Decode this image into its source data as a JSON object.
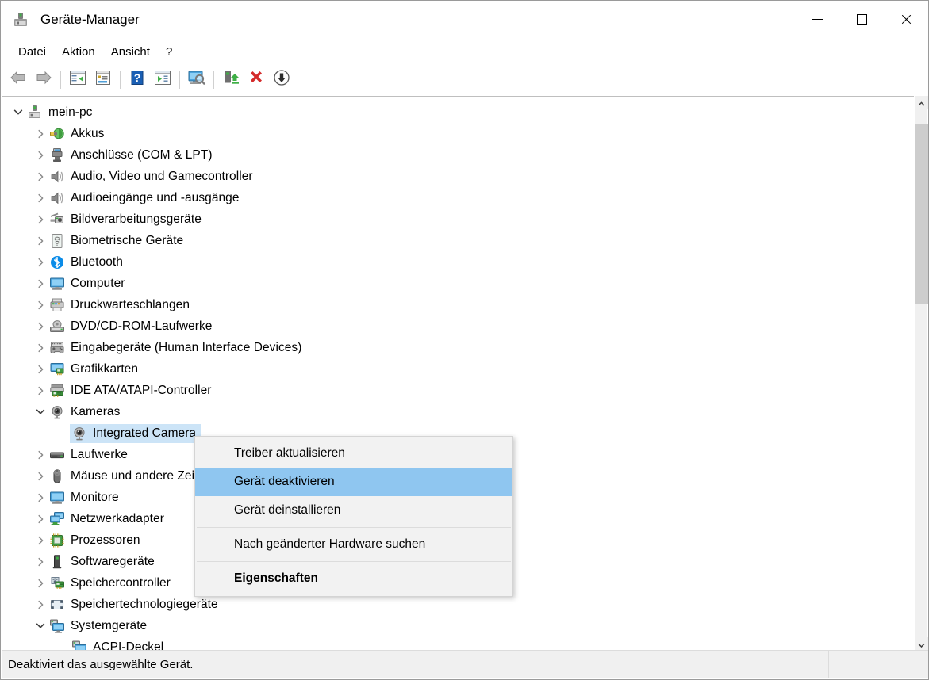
{
  "window": {
    "title": "Geräte-Manager",
    "icon": "device-manager-icon",
    "controls": {
      "minimize": "minimize-icon",
      "maximize": "maximize-icon",
      "close": "close-icon"
    }
  },
  "menubar": {
    "items": [
      {
        "label": "Datei",
        "name": "menu-datei"
      },
      {
        "label": "Aktion",
        "name": "menu-aktion"
      },
      {
        "label": "Ansicht",
        "name": "menu-ansicht"
      },
      {
        "label": "?",
        "name": "menu-hilfe"
      }
    ]
  },
  "toolbar": {
    "buttons": [
      {
        "icon": "back-arrow-icon",
        "name": "toolbar-back"
      },
      {
        "icon": "forward-arrow-icon",
        "name": "toolbar-forward"
      },
      {
        "sep": true
      },
      {
        "icon": "show-hide-console-tree-icon",
        "name": "toolbar-console-tree"
      },
      {
        "icon": "properties-icon",
        "name": "toolbar-properties"
      },
      {
        "sep": true
      },
      {
        "icon": "help-question-icon",
        "name": "toolbar-help"
      },
      {
        "icon": "update-driver-icon",
        "name": "toolbar-update-driver"
      },
      {
        "sep": true
      },
      {
        "icon": "scan-hardware-icon",
        "name": "toolbar-scan-hardware"
      },
      {
        "sep": true
      },
      {
        "icon": "enable-device-icon",
        "name": "toolbar-enable-device"
      },
      {
        "icon": "uninstall-device-red-x-icon",
        "name": "toolbar-uninstall-device"
      },
      {
        "icon": "disable-device-down-arrow-icon",
        "name": "toolbar-disable-device"
      }
    ]
  },
  "tree": {
    "rows": [
      {
        "label": "mein-pc",
        "depth": 0,
        "state": "expanded",
        "icon": "computer-root-icon",
        "selected": false
      },
      {
        "label": "Akkus",
        "depth": 1,
        "state": "collapsed",
        "icon": "battery-icon",
        "selected": false
      },
      {
        "label": "Anschlüsse (COM & LPT)",
        "depth": 1,
        "state": "collapsed",
        "icon": "port-connector-icon",
        "selected": false
      },
      {
        "label": "Audio, Video und Gamecontroller",
        "depth": 1,
        "state": "collapsed",
        "icon": "speaker-icon",
        "selected": false
      },
      {
        "label": "Audioeingänge und -ausgänge",
        "depth": 1,
        "state": "collapsed",
        "icon": "speaker-icon",
        "selected": false
      },
      {
        "label": "Bildverarbeitungsgeräte",
        "depth": 1,
        "state": "collapsed",
        "icon": "imaging-scanner-icon",
        "selected": false
      },
      {
        "label": "Biometrische Geräte",
        "depth": 1,
        "state": "collapsed",
        "icon": "fingerprint-icon",
        "selected": false
      },
      {
        "label": "Bluetooth",
        "depth": 1,
        "state": "collapsed",
        "icon": "bluetooth-icon",
        "selected": false
      },
      {
        "label": "Computer",
        "depth": 1,
        "state": "collapsed",
        "icon": "monitor-icon",
        "selected": false
      },
      {
        "label": "Druckwarteschlangen",
        "depth": 1,
        "state": "collapsed",
        "icon": "printer-icon",
        "selected": false
      },
      {
        "label": "DVD/CD-ROM-Laufwerke",
        "depth": 1,
        "state": "collapsed",
        "icon": "optical-drive-icon",
        "selected": false
      },
      {
        "label": "Eingabegeräte (Human Interface Devices)",
        "depth": 1,
        "state": "collapsed",
        "icon": "gamepad-hid-icon",
        "selected": false
      },
      {
        "label": "Grafikkarten",
        "depth": 1,
        "state": "collapsed",
        "icon": "display-adapter-icon",
        "selected": false
      },
      {
        "label": "IDE ATA/ATAPI-Controller",
        "depth": 1,
        "state": "collapsed",
        "icon": "ide-controller-icon",
        "selected": false
      },
      {
        "label": "Kameras",
        "depth": 1,
        "state": "expanded",
        "icon": "camera-icon",
        "selected": false
      },
      {
        "label": "Integrated Camera",
        "depth": 2,
        "state": "leaf",
        "icon": "camera-icon",
        "selected": true
      },
      {
        "label": "Laufwerke",
        "depth": 1,
        "state": "collapsed",
        "icon": "disk-drive-icon",
        "selected": false
      },
      {
        "label": "Mäuse und andere Zeigegeräte",
        "depth": 1,
        "state": "collapsed",
        "icon": "mouse-icon",
        "selected": false
      },
      {
        "label": "Monitore",
        "depth": 1,
        "state": "collapsed",
        "icon": "monitor-icon",
        "selected": false
      },
      {
        "label": "Netzwerkadapter",
        "depth": 1,
        "state": "collapsed",
        "icon": "network-adapter-icon",
        "selected": false
      },
      {
        "label": "Prozessoren",
        "depth": 1,
        "state": "collapsed",
        "icon": "cpu-icon",
        "selected": false
      },
      {
        "label": "Softwaregeräte",
        "depth": 1,
        "state": "collapsed",
        "icon": "software-device-icon",
        "selected": false
      },
      {
        "label": "Speichercontroller",
        "depth": 1,
        "state": "collapsed",
        "icon": "storage-controller-icon",
        "selected": false
      },
      {
        "label": "Speichertechnologiegeräte",
        "depth": 1,
        "state": "collapsed",
        "icon": "storage-spaces-icon",
        "selected": false
      },
      {
        "label": "Systemgeräte",
        "depth": 1,
        "state": "expanded",
        "icon": "system-device-icon",
        "selected": false
      },
      {
        "label": "ACPI-Deckel",
        "depth": 2,
        "state": "leaf",
        "icon": "system-device-icon",
        "selected": false
      }
    ]
  },
  "context_menu": {
    "items": [
      {
        "label": "Treiber aktualisieren",
        "name": "ctx-update-driver",
        "highlight": false,
        "bold": false
      },
      {
        "label": "Gerät deaktivieren",
        "name": "ctx-disable-device",
        "highlight": true,
        "bold": false
      },
      {
        "label": "Gerät deinstallieren",
        "name": "ctx-uninstall-device",
        "highlight": false,
        "bold": false
      },
      {
        "separator": true
      },
      {
        "label": "Nach geänderter Hardware suchen",
        "name": "ctx-scan-hardware-changes",
        "highlight": false,
        "bold": false
      },
      {
        "separator": true
      },
      {
        "label": "Eigenschaften",
        "name": "ctx-properties",
        "highlight": false,
        "bold": true
      }
    ]
  },
  "statusbar": {
    "message": "Deaktiviert das ausgewählte Gerät.",
    "cell2": "",
    "cell3": ""
  },
  "scrollbar": {
    "up_arrow": "chevron-up-icon",
    "down_arrow": "chevron-down-icon"
  },
  "colors": {
    "selection_blue": "#cce4f7",
    "menu_highlight_blue": "#8fc6f0",
    "toolbar_red": "#d42b2b",
    "accent_green": "#3faf46",
    "bluetooth_blue": "#0b8ce8"
  }
}
